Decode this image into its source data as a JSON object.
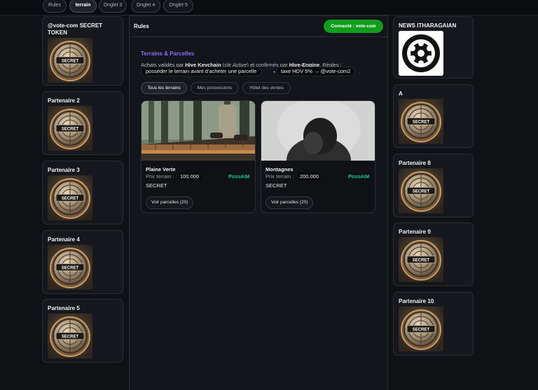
{
  "tabs": [
    {
      "label": "Rules",
      "active": false
    },
    {
      "label": "terrain",
      "active": true
    },
    {
      "label": "Onglet 3",
      "active": false
    },
    {
      "label": "Onglet 4",
      "active": false
    },
    {
      "label": "Onglet 5",
      "active": false
    }
  ],
  "left_partners": [
    {
      "name": "@vote-com SECRET TOKEN",
      "logo_text": "SECRET"
    },
    {
      "name": "Partenaire 2",
      "logo_text": "SECRET"
    },
    {
      "name": "Partenaire 3",
      "logo_text": "SECRET"
    },
    {
      "name": "Partenaire 4",
      "logo_text": "SECRET"
    },
    {
      "name": "Partenaire 5",
      "logo_text": "SECRET"
    }
  ],
  "right_partners": [
    {
      "name": "NEWS ITHARAGAIAN",
      "logo_text": ""
    },
    {
      "name": "A",
      "logo_text": "SECRET"
    },
    {
      "name": "Partenaire 8",
      "logo_text": "SECRET"
    },
    {
      "name": "Partenaire 9",
      "logo_text": "SECRET"
    },
    {
      "name": "Partenaire 10",
      "logo_text": "SECRET"
    }
  ],
  "main": {
    "title": "Rules",
    "status_badge": "Connecté : vote-com",
    "section_title": "Terrains & Parcelles",
    "desc_prefix": "Achats validés par ",
    "desc_keychain": "Hive Keychain",
    "desc_paren_open": " (clé ",
    "desc_active": "Active",
    "desc_paren_close": ") et confirmés par ",
    "desc_engine": "Hive-Engine",
    "desc_suffix": ". Règles :",
    "rule_1": "posséder le terrain avant d’acheter une parcelle",
    "rule_sep": "•",
    "rule_2": "taxe HDV 5% → @vote-com2",
    "rule_end": "."
  },
  "filters": [
    {
      "label": "Tous les terrains",
      "active": true
    },
    {
      "label": "Mes possessions",
      "active": false
    },
    {
      "label": "Hôtel des ventes",
      "active": false
    }
  ],
  "lands": [
    {
      "name": "Plaine Verte",
      "price_label": "Prix terrain :",
      "price": "100.000",
      "currency": "SECRET",
      "status": "Possédé",
      "button": "Voir parcelles (20)"
    },
    {
      "name": "Montagnes",
      "price_label": "Prix terrain :",
      "price": "200.000",
      "currency": "SECRET",
      "status": "Possédé",
      "button": "Voir parcelles (20)"
    }
  ],
  "colors": {
    "accent_purple": "#8c6cff",
    "status_green": "#0f9d1c",
    "owned_green": "#22c58a"
  }
}
